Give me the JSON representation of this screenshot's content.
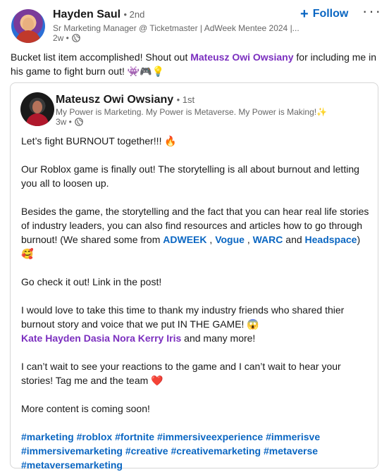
{
  "author": {
    "name": "Hayden Saul",
    "degree": "• 2nd",
    "headline": "Sr Marketing Manager @ Ticketmaster | AdWeek Mentee 2024 |...",
    "time": "2w •"
  },
  "actions": {
    "follow_label": "Follow",
    "more_label": "···"
  },
  "post": {
    "text_before": "Bucket list item accomplished! Shout out ",
    "mention": "Mateusz Owi Owsiany",
    "text_after": " for including me in his game to fight burn out! ",
    "emojis": "👾🎮💡"
  },
  "shared": {
    "author": {
      "name": "Mateusz Owi Owsiany",
      "degree": "• 1st",
      "headline": "My Power is Marketing. My Power is Metaverse. My Power is Making!✨",
      "time": "3w •"
    },
    "p1": "Let’s fight BURNOUT together!!! 🔥",
    "p2": "Our Roblox game is finally out! The storytelling is all about burnout and letting you all to loosen up.",
    "p3_text": "Besides the game, the storytelling and the fact that you can hear real life stories of industry leaders, you can also find resources and articles how to go through burnout! (We shared some from ",
    "p3_links": [
      "ADWEEK",
      "Vogue",
      "WARC",
      "Headspace"
    ],
    "p3_sep1": " , ",
    "p3_sep2": " , ",
    "p3_and": " and ",
    "p3_end": ") 🥰",
    "p4": "Go check it out! Link in the post!",
    "p5_text": "I would love to take this time to thank my industry friends who shared thier burnout story and voice that we put IN THE GAME! 😱",
    "p5_people": [
      "Kate",
      "Hayden",
      "Dasia",
      "Nora",
      "Kerry",
      "Iris"
    ],
    "p5_end": " and many more!",
    "p6": "I can’t wait to see your reactions to the game and I can’t wait to hear your stories! Tag me and the team ❤️",
    "p7": "More content is coming soon!",
    "hashtags": [
      "#marketing",
      "#roblox",
      "#fortnite",
      "#immersiveexperience",
      "#immerisve",
      "#immersivemarketing",
      "#creative",
      "#creativemarketing",
      "#metaverse",
      "#metaversemarketing"
    ]
  },
  "colors": {
    "link_blue": "#0a66c2",
    "mention_purple": "#7b2fbf",
    "muted": "#666666"
  }
}
